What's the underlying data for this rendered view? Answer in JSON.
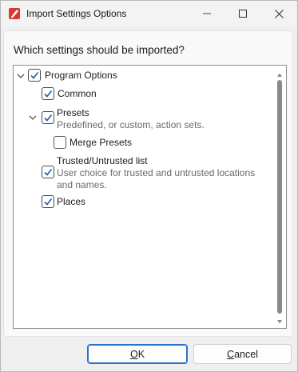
{
  "window": {
    "title": "Import Settings Options",
    "controls": {
      "minimize": "minimize-icon",
      "maximize": "maximize-icon",
      "close": "close-icon"
    }
  },
  "dialog": {
    "question": "Which settings should be imported?"
  },
  "tree": {
    "items": [
      {
        "label": "Program Options",
        "checked": true,
        "expanded": true
      },
      {
        "label": "Common",
        "checked": true
      },
      {
        "label": "Presets",
        "description": "Predefined, or custom, action sets.",
        "checked": true,
        "expanded": true
      },
      {
        "label": "Merge Presets",
        "checked": false
      },
      {
        "label": "Trusted/Untrusted list",
        "description_line1": "User choice for trusted and untrusted locations",
        "description_line2": "and names.",
        "checked": true
      },
      {
        "label": "Places",
        "checked": true
      }
    ]
  },
  "buttons": {
    "ok": {
      "accel": "O",
      "rest": "K"
    },
    "cancel": {
      "accel": "C",
      "rest": "ancel"
    }
  },
  "colors": {
    "accent": "#2a73c9",
    "app_icon": "#d63a2e"
  }
}
